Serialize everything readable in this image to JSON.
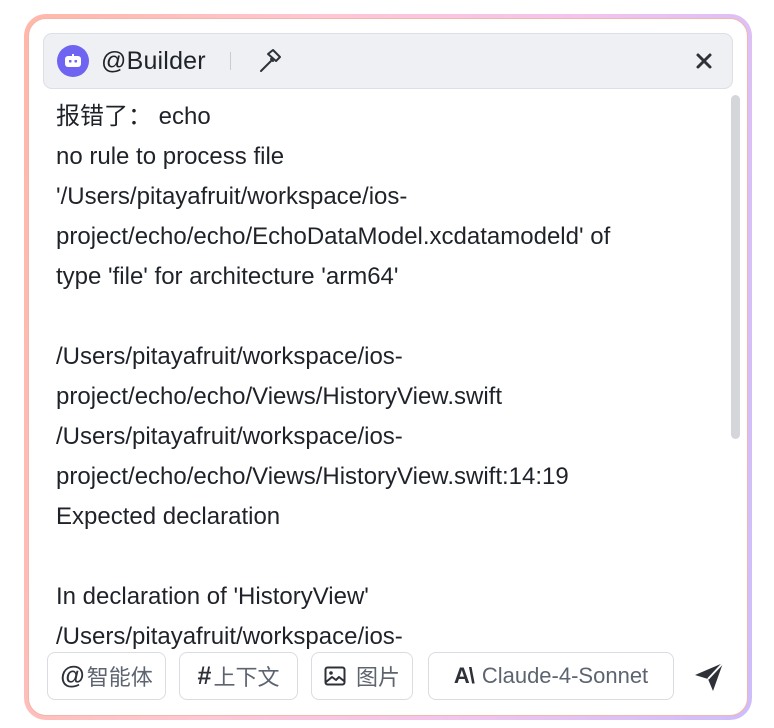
{
  "header": {
    "agent_name": "@Builder",
    "avatar_icon": "robot-icon",
    "tool_icon": "hammer-icon",
    "close_icon": "close-icon",
    "avatar_color": "#6f63f2"
  },
  "message": {
    "lines": [
      "报错了： echo",
      "no rule to process file",
      "'/Users/pitayafruit/workspace/ios-",
      "project/echo/echo/EchoDataModel.xcdatamodeld' of",
      "type 'file' for architecture 'arm64'",
      "",
      "/Users/pitayafruit/workspace/ios-",
      "project/echo/echo/Views/HistoryView.swift",
      "/Users/pitayafruit/workspace/ios-",
      "project/echo/echo/Views/HistoryView.swift:14:19",
      "Expected declaration",
      "",
      "In declaration of 'HistoryView'",
      "/Users/pitayafruit/workspace/ios-"
    ]
  },
  "toolbar": {
    "agent_symbol": "@",
    "agent_label": "智能体",
    "context_symbol": "#",
    "context_label": "上下文",
    "image_icon": "image-icon",
    "image_label": "图片",
    "model_logo": "A\\",
    "model_label": "Claude-4-Sonnet",
    "send_icon": "send-icon"
  },
  "colors": {
    "border_gradient": [
      "#ffb7a8",
      "#ffc7d4",
      "#f2c4ee",
      "#cdbdfb"
    ],
    "text": "#1f2329"
  }
}
